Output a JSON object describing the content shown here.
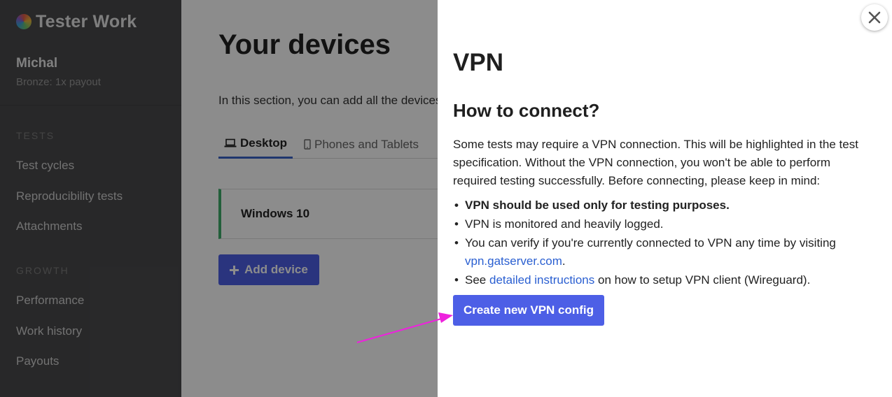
{
  "sidebar": {
    "brand": "Tester Work",
    "user_name": "Michal",
    "user_tier": "Bronze: 1x payout",
    "sections": [
      {
        "heading": "TESTS",
        "items": [
          "Test cycles",
          "Reproducibility tests",
          "Attachments"
        ]
      },
      {
        "heading": "GROWTH",
        "items": [
          "Performance",
          "Work history",
          "Payouts"
        ]
      }
    ]
  },
  "main": {
    "title": "Your devices",
    "intro": "In this section, you can add all the devices",
    "tabs": [
      {
        "label": "Desktop",
        "icon": "laptop-icon",
        "active": true
      },
      {
        "label": "Phones and Tablets",
        "icon": "phone-icon",
        "active": false
      }
    ],
    "device": "Windows 10",
    "add_device_label": "Add device"
  },
  "panel": {
    "title": "VPN",
    "subtitle": "How to connect?",
    "body": "Some tests may require a VPN connection. This will be highlighted in the test specification. Without the VPN connection, you won't be able to perform required testing successfully. Before connecting, please keep in mind:",
    "bullets": {
      "b1": "VPN should be used only for testing purposes.",
      "b2": "VPN is monitored and heavily logged.",
      "b3_text": "You can verify if you're currently connected to VPN any time by visiting",
      "b3_link": "vpn.gatserver.com",
      "b3_end": ".",
      "b4_pre": "See",
      "b4_link": "detailed instructions",
      "b4_post": "on how to setup VPN client (Wireguard)."
    },
    "create_button": "Create new VPN config",
    "close_icon": "close-icon"
  },
  "colors": {
    "sidebar_bg": "#4a4a4c",
    "accent": "#4d5fe6",
    "link": "#2a5fd1",
    "tab_active": "#3a63c9",
    "device_border": "#3fae6a",
    "annotation_arrow": "#ee22dd"
  }
}
